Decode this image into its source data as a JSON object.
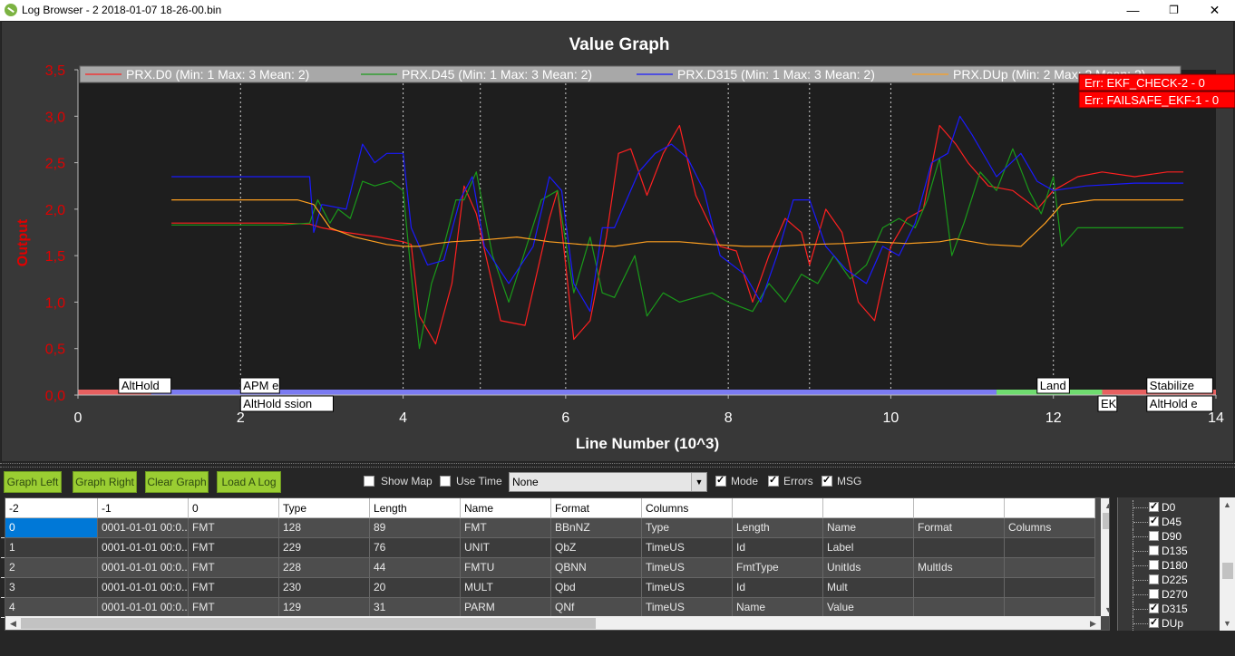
{
  "window": {
    "title": "Log Browser - 2 2018-01-07 18-26-00.bin",
    "min_glyph": "—",
    "max_glyph": "❐",
    "close_glyph": "✕"
  },
  "graph": {
    "errors": [
      "Err: EKF_CHECK-2 - 0",
      "Err: FAILSAFE_EKF-1 - 0"
    ],
    "mode_labels_top": [
      {
        "text": "AltHold",
        "x": 0.5
      },
      {
        "text": "APM e",
        "x": 2.0
      },
      {
        "text": "Land",
        "x": 11.8
      },
      {
        "text": "Stabilize",
        "x": 13.15
      }
    ],
    "mode_labels_bottom": [
      {
        "text": "AltHold ssion",
        "x": 2.0
      },
      {
        "text": "EK",
        "x": 12.55
      },
      {
        "text": "AltHold e",
        "x": 13.15
      }
    ],
    "mode_bands": [
      {
        "from": 0.0,
        "to": 0.9,
        "color": "#e86060"
      },
      {
        "from": 0.9,
        "to": 11.3,
        "color": "#7b7bf2"
      },
      {
        "from": 11.3,
        "to": 12.6,
        "color": "#6fdc6f"
      },
      {
        "from": 12.6,
        "to": 14.0,
        "color": "#e86060"
      }
    ],
    "vlines": [
      2.0,
      4.0,
      4.95,
      6.0,
      8.0,
      9.0,
      10.0,
      12.0
    ]
  },
  "chart_data": {
    "type": "line",
    "title": "Value Graph",
    "xlabel": "Line Number (10^3)",
    "ylabel": "Output",
    "xlim": [
      0,
      14
    ],
    "ylim": [
      0,
      3.5
    ],
    "x_ticks": [
      "0",
      "2",
      "4",
      "6",
      "8",
      "10",
      "12",
      "14"
    ],
    "y_ticks": [
      "0,0",
      "0,5",
      "1,0",
      "1,5",
      "2,0",
      "2,5",
      "3,0",
      "3,5"
    ],
    "grid": false,
    "legend_position": "top",
    "series": [
      {
        "name": "PRX.D0 (Min: 1 Max: 3 Mean: 2)",
        "color": "#ff2020",
        "x": [
          1.15,
          2.5,
          2.85,
          3.0,
          3.3,
          3.7,
          4.0,
          4.1,
          4.2,
          4.4,
          4.6,
          4.75,
          4.9,
          5.2,
          5.5,
          5.8,
          5.9,
          6.1,
          6.3,
          6.5,
          6.65,
          6.8,
          7.0,
          7.2,
          7.4,
          7.6,
          7.9,
          8.1,
          8.3,
          8.5,
          8.7,
          8.9,
          9.0,
          9.2,
          9.4,
          9.6,
          9.8,
          10.0,
          10.2,
          10.4,
          10.6,
          10.8,
          10.95,
          11.2,
          11.5,
          11.8,
          12.0,
          12.3,
          12.6,
          13.0,
          13.4,
          13.6
        ],
        "y": [
          1.85,
          1.85,
          1.84,
          1.8,
          1.75,
          1.7,
          1.65,
          1.62,
          0.85,
          0.55,
          1.2,
          2.25,
          1.95,
          0.8,
          0.75,
          1.9,
          2.2,
          0.6,
          0.8,
          1.7,
          2.6,
          2.65,
          2.15,
          2.6,
          2.9,
          2.15,
          1.6,
          1.55,
          1.0,
          1.5,
          1.9,
          1.75,
          1.4,
          2.0,
          1.75,
          1.0,
          0.8,
          1.6,
          1.9,
          2.0,
          2.9,
          2.7,
          2.5,
          2.25,
          2.2,
          2.0,
          2.2,
          2.35,
          2.4,
          2.35,
          2.4,
          2.4
        ]
      },
      {
        "name": "PRX.D45 (Min: 1 Max: 3 Mean: 2)",
        "color": "#1a9a1a",
        "x": [
          1.15,
          2.5,
          2.85,
          2.95,
          3.1,
          3.2,
          3.35,
          3.5,
          3.65,
          3.85,
          4.0,
          4.1,
          4.2,
          4.35,
          4.5,
          4.65,
          4.75,
          4.9,
          5.1,
          5.3,
          5.5,
          5.7,
          5.9,
          6.1,
          6.3,
          6.45,
          6.6,
          6.85,
          7.0,
          7.2,
          7.4,
          7.6,
          7.8,
          8.0,
          8.3,
          8.5,
          8.7,
          8.9,
          9.1,
          9.3,
          9.5,
          9.7,
          9.9,
          10.1,
          10.3,
          10.45,
          10.6,
          10.75,
          10.9,
          11.1,
          11.3,
          11.5,
          11.7,
          11.85,
          12.0,
          12.1,
          12.3,
          13.0,
          13.6
        ],
        "y": [
          1.83,
          1.83,
          1.85,
          2.1,
          1.85,
          2.0,
          1.9,
          2.3,
          2.25,
          2.3,
          2.2,
          1.3,
          0.5,
          1.2,
          1.6,
          2.1,
          2.1,
          2.4,
          1.5,
          1.0,
          1.55,
          2.1,
          2.2,
          1.1,
          1.7,
          1.1,
          1.05,
          1.5,
          0.85,
          1.1,
          1.0,
          1.05,
          1.1,
          1.0,
          0.9,
          1.2,
          1.0,
          1.3,
          1.2,
          1.5,
          1.25,
          1.4,
          1.8,
          1.9,
          1.8,
          2.1,
          2.55,
          1.5,
          1.85,
          2.4,
          2.2,
          2.65,
          2.2,
          1.95,
          2.35,
          1.6,
          1.8,
          1.8,
          1.8
        ]
      },
      {
        "name": "PRX.D315 (Min: 1 Max: 3 Mean: 2)",
        "color": "#1a1aff",
        "x": [
          1.15,
          2.5,
          2.85,
          2.9,
          3.0,
          3.3,
          3.5,
          3.65,
          3.8,
          4.0,
          4.1,
          4.3,
          4.5,
          4.7,
          4.85,
          5.0,
          5.3,
          5.6,
          5.8,
          5.95,
          6.1,
          6.3,
          6.45,
          6.6,
          6.9,
          7.1,
          7.3,
          7.5,
          7.7,
          7.9,
          8.2,
          8.4,
          8.6,
          8.8,
          9.0,
          9.2,
          9.45,
          9.7,
          9.9,
          10.1,
          10.3,
          10.5,
          10.7,
          10.85,
          11.0,
          11.3,
          11.6,
          11.8,
          12.0,
          12.4,
          13.0,
          13.6
        ],
        "y": [
          2.35,
          2.35,
          2.35,
          1.75,
          2.05,
          2.0,
          2.7,
          2.5,
          2.6,
          2.6,
          1.8,
          1.4,
          1.45,
          2.1,
          2.35,
          1.6,
          1.2,
          1.6,
          2.35,
          2.2,
          1.2,
          0.9,
          1.8,
          1.8,
          2.4,
          2.6,
          2.7,
          2.55,
          2.2,
          1.5,
          1.3,
          1.0,
          1.5,
          2.1,
          2.1,
          1.6,
          1.35,
          1.2,
          1.6,
          1.5,
          1.85,
          2.5,
          2.6,
          3.0,
          2.8,
          2.35,
          2.6,
          2.3,
          2.2,
          2.25,
          2.28,
          2.28
        ]
      },
      {
        "name": "PRX.DUp (Min: 2 Max: 2 Mean: 2)",
        "color": "#ffa020",
        "x": [
          1.15,
          2.7,
          2.9,
          3.1,
          3.4,
          3.8,
          4.0,
          4.2,
          4.4,
          4.6,
          5.0,
          5.4,
          5.8,
          6.2,
          6.6,
          7.0,
          7.4,
          7.8,
          8.2,
          8.6,
          9.0,
          9.4,
          9.8,
          10.2,
          10.6,
          10.8,
          11.2,
          11.6,
          11.9,
          12.1,
          12.5,
          13.0,
          13.6
        ],
        "y": [
          2.1,
          2.1,
          2.05,
          1.8,
          1.7,
          1.62,
          1.6,
          1.6,
          1.63,
          1.65,
          1.67,
          1.7,
          1.65,
          1.62,
          1.6,
          1.65,
          1.65,
          1.62,
          1.6,
          1.6,
          1.62,
          1.63,
          1.65,
          1.63,
          1.65,
          1.68,
          1.62,
          1.6,
          1.85,
          2.05,
          2.1,
          2.1,
          2.1
        ]
      }
    ]
  },
  "toolbar": {
    "graph_left": "Graph Left",
    "graph_right": "Graph Right",
    "clear_graph": "Clear Graph",
    "load_log": "Load A Log",
    "show_map": "Show Map",
    "use_time": "Use Time",
    "time_select_value": "None",
    "mode": "Mode",
    "errors": "Errors",
    "msg": "MSG"
  },
  "checks": {
    "show_map": false,
    "use_time": false,
    "mode": true,
    "errors": true,
    "msg": true
  },
  "table": {
    "headers": [
      "-2",
      "-1",
      "0",
      "Type",
      "Length",
      "Name",
      "Format",
      "Columns",
      "",
      "",
      "",
      ""
    ],
    "rows": [
      [
        "0",
        "0001-01-01 00:0...",
        "FMT",
        "128",
        "89",
        "FMT",
        "BBnNZ",
        "Type",
        "Length",
        "Name",
        "Format",
        "Columns"
      ],
      [
        "1",
        "0001-01-01 00:0...",
        "FMT",
        "229",
        "76",
        "UNIT",
        "QbZ",
        "TimeUS",
        "Id",
        "Label",
        "",
        ""
      ],
      [
        "2",
        "0001-01-01 00:0...",
        "FMT",
        "228",
        "44",
        "FMTU",
        "QBNN",
        "TimeUS",
        "FmtType",
        "UnitIds",
        "MultIds",
        ""
      ],
      [
        "3",
        "0001-01-01 00:0...",
        "FMT",
        "230",
        "20",
        "MULT",
        "Qbd",
        "TimeUS",
        "Id",
        "Mult",
        "",
        ""
      ],
      [
        "4",
        "0001-01-01 00:0...",
        "FMT",
        "129",
        "31",
        "PARM",
        "QNf",
        "TimeUS",
        "Name",
        "Value",
        "",
        ""
      ]
    ]
  },
  "series_list": [
    {
      "label": "D0",
      "checked": true
    },
    {
      "label": "D45",
      "checked": true
    },
    {
      "label": "D90",
      "checked": false
    },
    {
      "label": "D135",
      "checked": false
    },
    {
      "label": "D180",
      "checked": false
    },
    {
      "label": "D225",
      "checked": false
    },
    {
      "label": "D270",
      "checked": false
    },
    {
      "label": "D315",
      "checked": true
    },
    {
      "label": "DUp",
      "checked": true
    }
  ]
}
